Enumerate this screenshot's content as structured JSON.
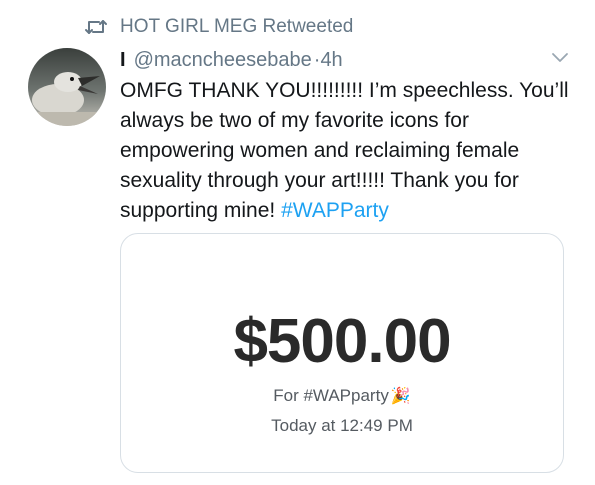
{
  "retweet": {
    "icon": "retweet-icon",
    "label": "HOT GIRL MEG Retweeted"
  },
  "tweet": {
    "display_name": "I",
    "handle": "@macncheesebabe",
    "separator": "·",
    "time": "4h",
    "avatar_icon": "bird-avatar",
    "menu_icon": "chevron-down-icon",
    "text": "OMFG THANK YOU!!!!!!!!! I’m speechless. You’ll always be two of my favorite icons for empowering women and reclaiming female sexuality through your art!!!!! Thank you for supporting mine! ",
    "hashtag": "#WAPParty"
  },
  "payment_card": {
    "amount": "$500.00",
    "note": "For #WAPparty",
    "note_emoji": "🎉",
    "timestamp": "Today at 12:49 PM"
  },
  "colors": {
    "text": "#14171a",
    "muted": "#657786",
    "link": "#1da1f2",
    "card_border": "#d8dfe5"
  }
}
